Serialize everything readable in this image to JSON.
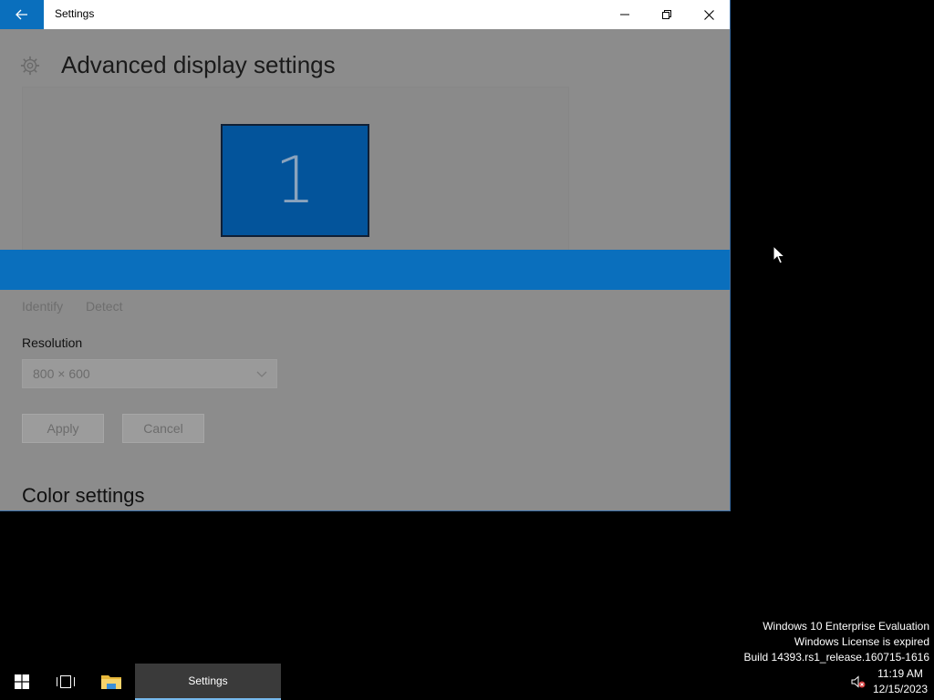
{
  "window": {
    "title": "Settings",
    "back_icon": "arrow-left-icon",
    "controls": [
      "minimize-icon",
      "restore-icon",
      "close-icon"
    ],
    "accent_color": "#0a6fbd"
  },
  "page": {
    "title": "Advanced display settings",
    "monitor_number": "1",
    "identify_label": "Identify",
    "detect_label": "Detect",
    "resolution_label": "Resolution",
    "resolution_value": "800 × 600",
    "apply_label": "Apply",
    "cancel_label": "Cancel",
    "color_settings_title": "Color settings"
  },
  "watermark": {
    "line1": "Windows 10 Enterprise Evaluation",
    "line2": "Windows License is expired",
    "line3": "Build 14393.rs1_release.160715-1616"
  },
  "taskbar": {
    "active_app_label": "Settings",
    "time": "11:19 AM",
    "date": "12/15/2023"
  }
}
